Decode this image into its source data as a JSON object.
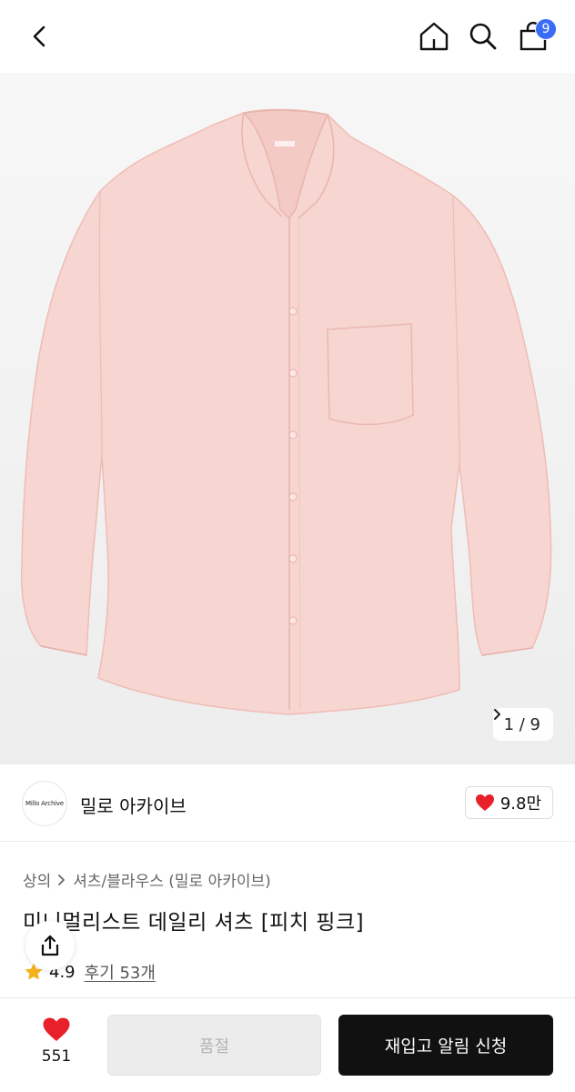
{
  "header": {
    "icons": [
      "chevron-left-icon",
      "home-icon",
      "search-icon",
      "shopping-bag-icon"
    ],
    "cart_count": "9"
  },
  "gallery": {
    "counter": "1 / 9",
    "background_color": "#efefef",
    "product_color": "#f7d5d0"
  },
  "brand": {
    "logo_text": "Millo Archive",
    "name": "밀로 아카이브",
    "likes": "9.8만",
    "heart_color": "#e8202a"
  },
  "breadcrumb": {
    "root": "상의",
    "category": "셔츠/블라우스 (밀로 아카이브)"
  },
  "product": {
    "title": "미니멀리스트 데일리 셔츠 [피치 핑크]",
    "rating": "4.9",
    "reviews": "후기 53개"
  },
  "bottom": {
    "wish_count": "551",
    "soldout_label": "품절",
    "restock_label": "재입고 알림 신청"
  }
}
